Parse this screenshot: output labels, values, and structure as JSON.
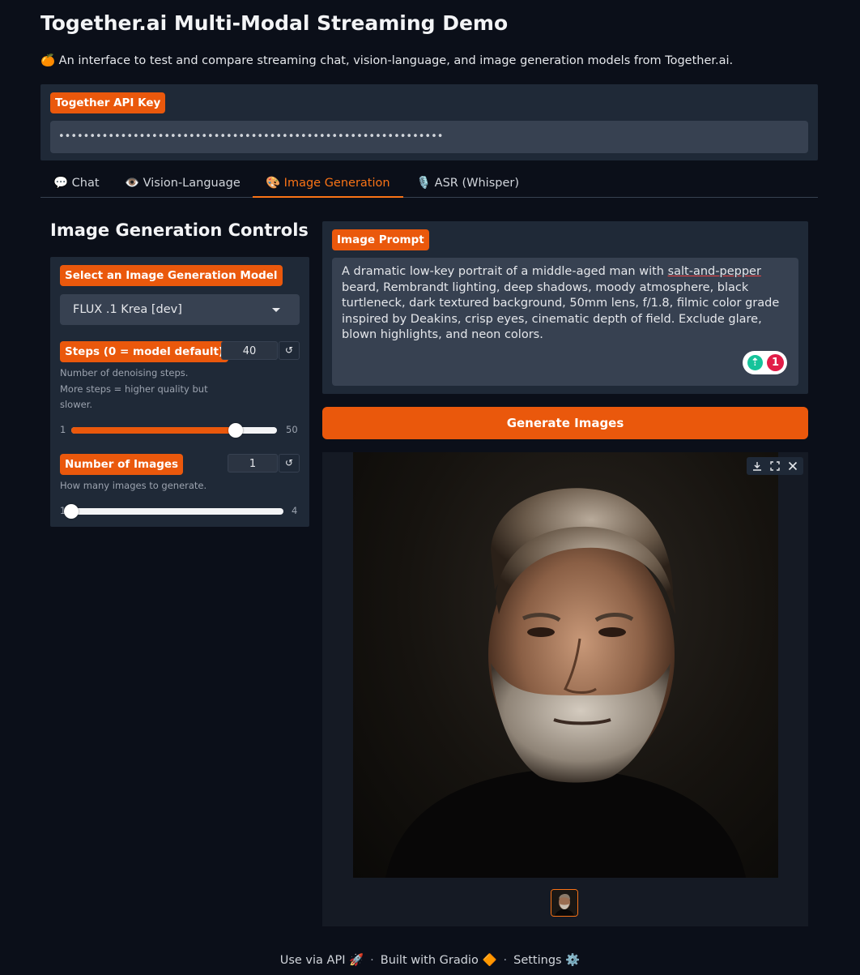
{
  "header": {
    "title": "Together.ai Multi-Modal Streaming Demo",
    "subtitle_emoji": "🍊",
    "subtitle": "An interface to test and compare streaming chat, vision-language, and image generation models from Together.ai."
  },
  "api_key": {
    "label": "Together API Key",
    "masked_value": "••••••••••••••••••••••••••••••••••••••••••••••••••••••••••••••"
  },
  "tabs": [
    {
      "icon": "💬",
      "label": "Chat"
    },
    {
      "icon": "👁️",
      "label": "Vision-Language"
    },
    {
      "icon": "🎨",
      "label": "Image Generation"
    },
    {
      "icon": "🎙️",
      "label": "ASR (Whisper)"
    }
  ],
  "active_tab": "Image Generation",
  "controls": {
    "title": "Image Generation Controls",
    "model": {
      "label": "Select an Image Generation Model",
      "value": "FLUX .1 Krea [dev]"
    },
    "steps": {
      "label": "Steps (0 = model default)",
      "value": "40",
      "info_lines": [
        "Number of denoising steps.",
        "More steps = higher quality but",
        "slower."
      ],
      "min": "1",
      "max": "50",
      "fraction": 0.8
    },
    "num_images": {
      "label": "Number of Images",
      "value": "1",
      "info": "How many images to generate.",
      "min": "1",
      "max": "4",
      "fraction": 0.0
    },
    "reset_glyph": "↺"
  },
  "prompt": {
    "label": "Image Prompt",
    "text_before": "A dramatic low-key portrait of a middle-aged man with ",
    "text_flagged": "salt-and-pepper",
    "text_after": " beard, Rembrandt lighting, deep shadows, moody atmosphere, black turtleneck, dark textured background, 50mm lens, f/1.8, filmic color grade inspired by Deakins, crisp eyes, cinematic depth of field. Exclude glare, blown highlights, and neon colors.",
    "grammarly_count": "1"
  },
  "generate_button": "Generate Images",
  "footer": {
    "api": "Use via API",
    "api_emoji": "🚀",
    "built": "Built with Gradio",
    "built_emoji": "🔶",
    "settings": "Settings",
    "settings_emoji": "⚙️",
    "separator": "·"
  },
  "colors": {
    "accent": "#ea580c",
    "accent_text": "#f97316",
    "background": "#0b0f19",
    "panel": "#1f2937",
    "input": "#374151"
  }
}
